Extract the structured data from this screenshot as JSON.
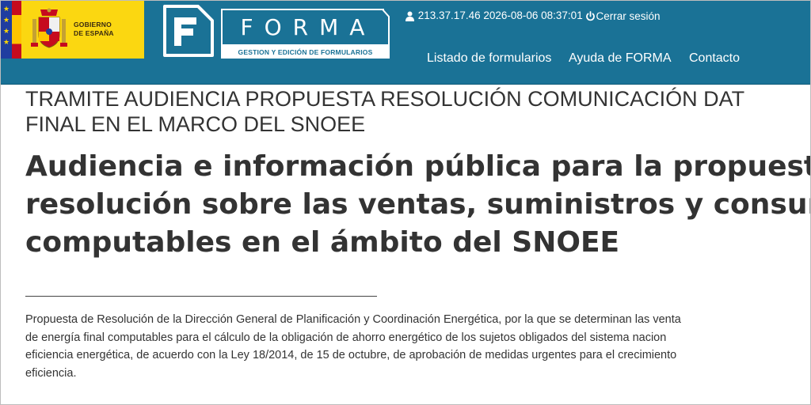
{
  "header": {
    "gov_label_line1": "GOBIERNO",
    "gov_label_line2": "DE ESPAÑA",
    "logo_word": "FORMA",
    "logo_subtitle": "GESTION Y EDICIÓN DE FORMULARIOS",
    "user_info": "213.37.17.46 2026-08-06 08:37:01",
    "logout_label": "Cerrar sesión",
    "nav": [
      {
        "label": "Listado de formularios"
      },
      {
        "label": "Ayuda de FORMA"
      },
      {
        "label": "Contacto"
      }
    ],
    "colors": {
      "header_bg": "#1a7296",
      "gov_yellow": "#fbd711",
      "text": "#ffffff"
    },
    "icons": [
      "user-icon",
      "power-icon",
      "eu-flag-icon",
      "spain-flag-icon",
      "coat-of-arms-icon",
      "forma-logo-icon"
    ]
  },
  "main": {
    "tramite_line1": "TRAMITE AUDIENCIA PROPUESTA RESOLUCIÓN COMUNICACIÓN DAT",
    "tramite_line2": "FINAL EN EL MARCO DEL SNOEE",
    "title_line1": "Audiencia e información pública para la propuest",
    "title_line2": "resolución sobre las ventas, suministros y consum",
    "title_line3": "computables en el ámbito del SNOEE",
    "description_lines": [
      "Propuesta de Resolución de la Dirección General de Planificación y Coordinación Energética, por la que se determinan las venta",
      "de energía final computables para el cálculo de la obligación de ahorro energético de los sujetos obligados del sistema nacion",
      "eficiencia energética, de acuerdo con la Ley 18/2014, de 15 de octubre, de aprobación de medidas urgentes para el crecimiento",
      "eficiencia."
    ],
    "colors": {
      "text": "#333333",
      "rule": "#444444"
    }
  }
}
